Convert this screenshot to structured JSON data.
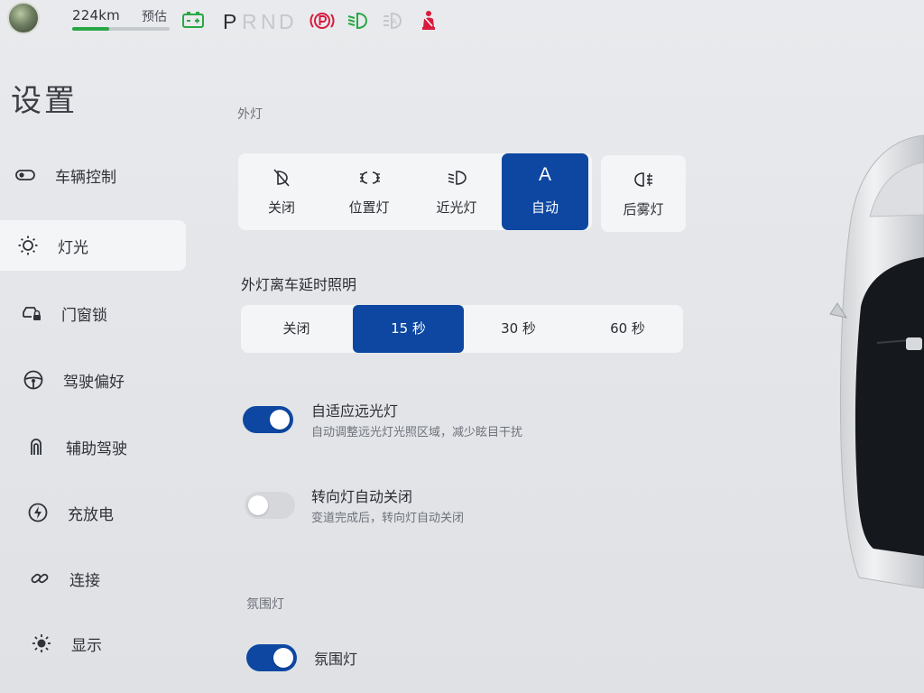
{
  "status_bar": {
    "range_value": "224km",
    "range_label": "预估",
    "range_fraction": 0.38,
    "gears": [
      "P",
      "R",
      "N",
      "D"
    ],
    "active_gear": "P",
    "colors": {
      "range": "#28a745",
      "battery": "#28a745",
      "brake": "#d81b3c",
      "lowbeam": "#28a745",
      "seatbelt": "#d81b3c",
      "inactive": "#c4c7cc"
    },
    "icons": [
      "battery-icon",
      "parking-brake-icon",
      "low-beam-indicator-icon",
      "auto-headlight-indicator-icon",
      "seatbelt-warning-icon"
    ]
  },
  "sidebar": {
    "title": "设置",
    "items": [
      {
        "label": "车辆控制",
        "icon": "toggle-icon",
        "active": false
      },
      {
        "label": "灯光",
        "icon": "sun-outline-icon",
        "active": true
      },
      {
        "label": "门窗锁",
        "icon": "car-lock-icon",
        "active": false
      },
      {
        "label": "驾驶偏好",
        "icon": "steering-wheel-icon",
        "active": false
      },
      {
        "label": "辅助驾驶",
        "icon": "assist-drive-icon",
        "active": false
      },
      {
        "label": "充放电",
        "icon": "charging-bolt-icon",
        "active": false
      },
      {
        "label": "连接",
        "icon": "link-icon",
        "active": false
      },
      {
        "label": "显示",
        "icon": "brightness-icon",
        "active": false
      }
    ]
  },
  "exterior": {
    "section_label": "外灯",
    "options": [
      {
        "label": "关闭",
        "icon": "light-off-icon",
        "selected": false
      },
      {
        "label": "位置灯",
        "icon": "position-light-icon",
        "selected": false
      },
      {
        "label": "近光灯",
        "icon": "low-beam-icon",
        "selected": false
      },
      {
        "label": "自动",
        "icon_text": "A",
        "selected": true
      }
    ],
    "fog": {
      "label": "后雾灯",
      "icon": "rear-fog-icon"
    }
  },
  "delay": {
    "title": "外灯离车延时照明",
    "options": [
      {
        "label": "关闭",
        "selected": false
      },
      {
        "label": "15 秒",
        "selected": true
      },
      {
        "label": "30 秒",
        "selected": false
      },
      {
        "label": "60 秒",
        "selected": false
      }
    ]
  },
  "adaptive_beam": {
    "title": "自适应远光灯",
    "subtitle": "自动调整远光灯光照区域，减少眩目干扰",
    "on": true
  },
  "turn_signal": {
    "title": "转向灯自动关闭",
    "subtitle": "变道完成后，转向灯自动关闭",
    "on": false
  },
  "ambient": {
    "section_label": "氛围灯",
    "title": "氛围灯",
    "on": true
  },
  "accent_color": "#0d47a1"
}
